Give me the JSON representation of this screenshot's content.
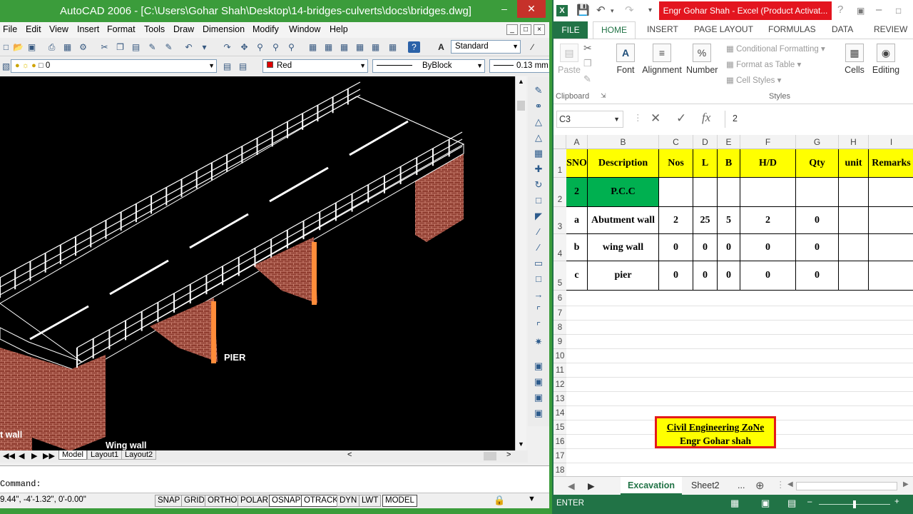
{
  "acad": {
    "title": "AutoCAD 2006 - [C:\\Users\\Gohar Shah\\Desktop\\14-bridges-culverts\\docs\\bridges.dwg]",
    "menus": [
      "File",
      "Edit",
      "View",
      "Insert",
      "Format",
      "Tools",
      "Draw",
      "Dimension",
      "Modify",
      "Window",
      "Help"
    ],
    "text_style": "Standard",
    "layer": "0",
    "color": "Red",
    "linetype": "ByBlock",
    "lineweight": "0.13 mm",
    "labels": {
      "pier": "PIER",
      "wing_wall": "Wing wall",
      "abutment_wall": "t wall"
    },
    "layout_tabs": [
      "Model",
      "Layout1",
      "Layout2"
    ],
    "command_prompt": "Command:",
    "coords": "9.44\", -4'-1.32\", 0'-0.00\"",
    "status_buttons": [
      "SNAP",
      "GRID",
      "ORTHO",
      "POLAR",
      "OSNAP",
      "OTRACK",
      "DYN",
      "LWT",
      "MODEL"
    ],
    "colors": {
      "brick": "#9c4a3a",
      "pier_accent": "#ff8c3a",
      "deck_line": "#ffffff",
      "canvas": "#000000"
    }
  },
  "excel": {
    "title": "Engr Gohar Shah -  Excel (Product Activat...",
    "tabs": {
      "file": "FILE",
      "home": "HOME",
      "insert": "INSERT",
      "page_layout": "PAGE LAYOUT",
      "formulas": "FORMULAS",
      "data": "DATA",
      "review": "REVIEW"
    },
    "ribbon": {
      "paste": "Paste",
      "clipboard": "Clipboard",
      "font": "Font",
      "alignment": "Alignment",
      "number": "Number",
      "conditional": "Conditional Formatting",
      "format_table": "Format as Table",
      "cell_styles": "Cell Styles",
      "styles": "Styles",
      "cells": "Cells",
      "editing": "Editing"
    },
    "name_box": "C3",
    "formula_value": "2",
    "columns": [
      "A",
      "B",
      "C",
      "D",
      "E",
      "F",
      "G",
      "H",
      "I"
    ],
    "rows": [
      "1",
      "2",
      "3",
      "4",
      "5",
      "6",
      "7",
      "8",
      "9",
      "10",
      "11",
      "12",
      "13",
      "14",
      "15",
      "16",
      "17",
      "18"
    ],
    "table": {
      "headers": [
        "SNO",
        "Description",
        "Nos",
        "L",
        "B",
        "H/D",
        "Qty",
        "unit",
        "Remarks"
      ],
      "section": {
        "sno": "2",
        "desc": "P.C.C"
      },
      "data": [
        [
          "a",
          "Abutment wall",
          "2",
          "25",
          "5",
          "2",
          "0",
          "",
          ""
        ],
        [
          "b",
          "wing wall",
          "0",
          "0",
          "0",
          "0",
          "0",
          "",
          ""
        ],
        [
          "c",
          "pier",
          "0",
          "0",
          "0",
          "0",
          "0",
          "",
          ""
        ]
      ]
    },
    "badge": {
      "line1": "Civil Engineering ZoNe",
      "line2": "Engr Gohar shah"
    },
    "sheets": [
      "Excavation",
      "Sheet2"
    ],
    "status": "ENTER",
    "colors": {
      "accent": "#217346",
      "header_fill": "#ffff00",
      "section_fill": "#00b050",
      "title_fill": "#e3151f"
    }
  }
}
